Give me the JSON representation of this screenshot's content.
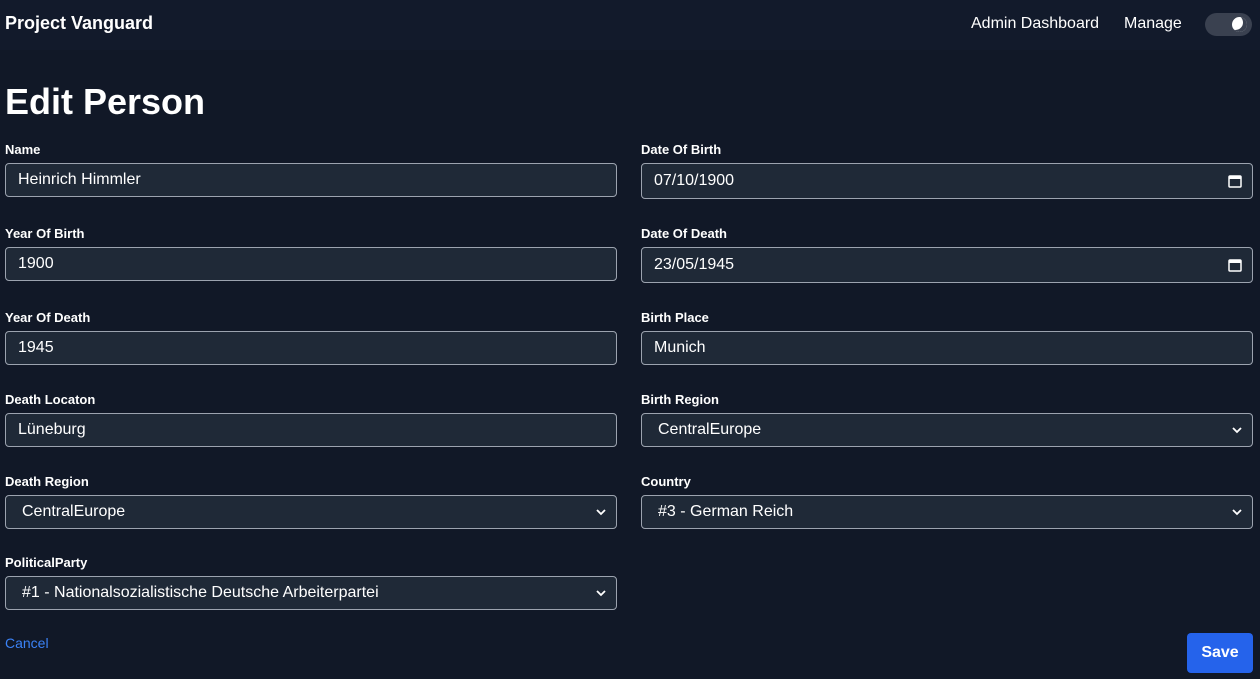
{
  "nav": {
    "brand": "Project Vanguard",
    "admin_dashboard": "Admin Dashboard",
    "manage": "Manage",
    "theme_toggle_icon": "moon-icon"
  },
  "page": {
    "title": "Edit Person"
  },
  "form": {
    "name": {
      "label": "Name",
      "value": "Heinrich Himmler"
    },
    "date_of_birth": {
      "label": "Date Of Birth",
      "value": "07/10/1900"
    },
    "year_of_birth": {
      "label": "Year Of Birth",
      "value": "1900"
    },
    "date_of_death": {
      "label": "Date Of Death",
      "value": "23/05/1945"
    },
    "year_of_death": {
      "label": "Year Of Death",
      "value": "1945"
    },
    "birth_place": {
      "label": "Birth Place",
      "value": "Munich"
    },
    "death_location": {
      "label": "Death Locaton",
      "value": "Lüneburg"
    },
    "birth_region": {
      "label": "Birth Region",
      "value": "CentralEurope"
    },
    "death_region": {
      "label": "Death Region",
      "value": "CentralEurope"
    },
    "country": {
      "label": "Country",
      "value": "#3 - German Reich"
    },
    "political_party": {
      "label": "PoliticalParty",
      "value": "#1 - Nationalsozialistische Deutsche Arbeiterpartei"
    }
  },
  "actions": {
    "cancel": "Cancel",
    "save": "Save"
  },
  "colors": {
    "background": "#111827",
    "navbar": "#121a2b",
    "input_bg": "#1f2937",
    "accent": "#2563eb",
    "link": "#3b82f6"
  }
}
